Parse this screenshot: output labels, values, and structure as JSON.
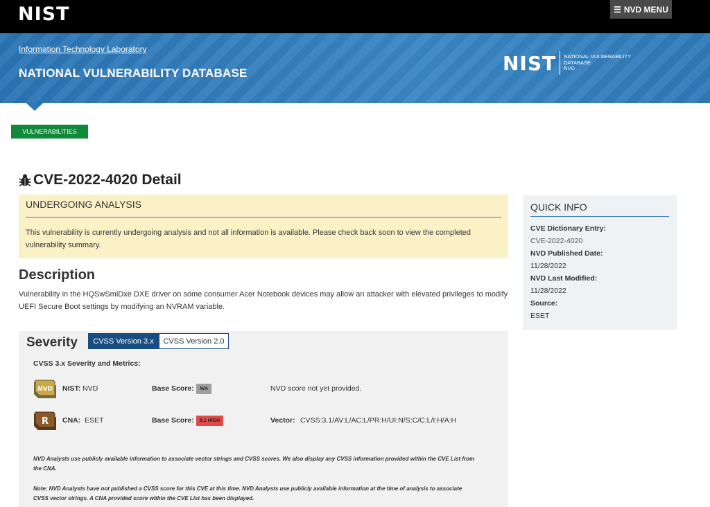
{
  "header": {
    "logo_text": "NIST",
    "menu_label": "NVD MENU"
  },
  "banner": {
    "itl_link": "Information Technology Laboratory",
    "title": "NATIONAL VULNERABILITY DATABASE",
    "logo_text": "NIST",
    "logo_sub1": "NATIONAL VULNERABILITY",
    "logo_sub2": "DATABASE",
    "logo_sub3": "NVD"
  },
  "nav": {
    "vulnerabilities_tab": "VULNERABILITIES"
  },
  "page": {
    "title": "CVE-2022-4020 Detail"
  },
  "analysis": {
    "heading": "UNDERGOING ANALYSIS",
    "text": "This vulnerability is currently undergoing analysis and not all information is available. Please check back soon to view the completed vulnerability summary."
  },
  "description": {
    "heading": "Description",
    "text": "Vulnerability in the HQSwSmiDxe DXE driver on some consumer Acer Notebook devices may allow an attacker with elevated privileges to modify UEFI Secure Boot settings by modifying an NVRAM variable."
  },
  "severity": {
    "heading": "Severity",
    "tab_cvss3": "CVSS Version 3.x",
    "tab_cvss2": "CVSS Version 2.0",
    "metrics_heading": "CVSS 3.x Severity and Metrics:",
    "nist_badge": "NVD",
    "nist_label": "NIST:",
    "nist_value": "NVD",
    "base_score_label": "Base Score:",
    "nist_score": "N/A",
    "nist_note": "NVD score not yet provided.",
    "cna_badge": "R",
    "cna_label": "CNA:",
    "cna_value": "ESET",
    "cna_score": "8.1 HIGH",
    "vector_label": "Vector:",
    "vector_value": "CVSS:3.1/AV:L/AC:L/PR:H/UI:N/S:C/C:L/I:H/A:H",
    "fine1": "NVD Analysts use publicly available information to associate vector strings and CVSS scores. We also display any CVSS information provided within the CVE List from the CNA.",
    "fine2": "Note: NVD Analysts have not published a CVSS score for this CVE at this time. NVD Analysts use publicly available information at the time of analysis to associate CVSS vector strings. A CNA provided score within the CVE List has been displayed."
  },
  "quick_info": {
    "heading": "QUICK INFO",
    "dict_label": "CVE Dictionary Entry:",
    "dict_value": "CVE-2022-4020",
    "published_label": "NVD Published Date:",
    "published_value": "11/28/2022",
    "modified_label": "NVD Last Modified:",
    "modified_value": "11/28/2022",
    "source_label": "Source:",
    "source_value": "ESET"
  },
  "colors": {
    "banner_blue": "#2f7ab9",
    "tab_green": "#11893b",
    "tab_active": "#194d80",
    "score_high": "#e04a4a",
    "score_na": "#9e9e9e",
    "analysis_bg": "#faf1c7"
  },
  "icons": [
    "menu-icon",
    "bug-icon",
    "nvd-badge-icon",
    "cna-badge-icon"
  ]
}
